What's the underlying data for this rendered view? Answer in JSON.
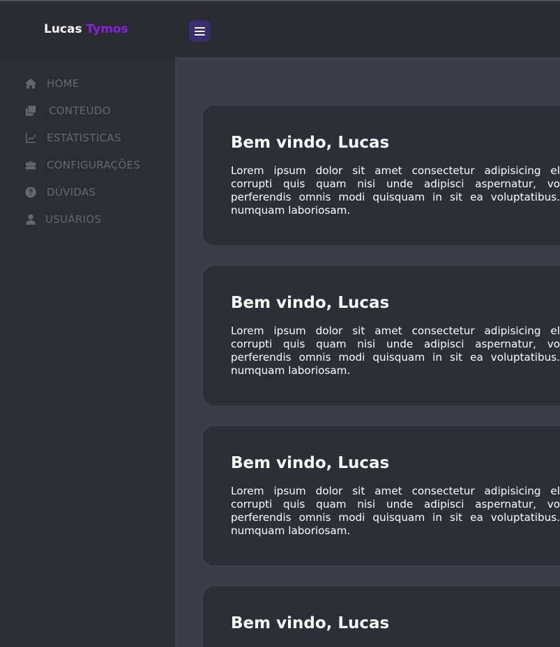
{
  "header": {
    "brand_first": "Lucas",
    "brand_second": "Tymos",
    "brand_accent_color": "#8a1fe0",
    "menu_icon": "hamburger-icon"
  },
  "sidebar": {
    "items": [
      {
        "label": "HOME",
        "icon": "home-icon"
      },
      {
        "label": "CONTEÚDO",
        "icon": "content-icon"
      },
      {
        "label": "ESTÁTISTICAS",
        "icon": "chart-line-icon"
      },
      {
        "label": "CONFIGURAÇÕES",
        "icon": "toolbox-icon"
      },
      {
        "label": "DÚVIDAS",
        "icon": "question-circle-icon"
      },
      {
        "label": "USUÁRIOS",
        "icon": "user-icon"
      }
    ]
  },
  "main": {
    "cards": [
      {
        "title": "Bem vindo, Lucas",
        "text": "Lorem ipsum dolor sit amet consectetur adipisicing el corrupti quis quam nisi unde adipisci aspernatur, vo perferendis omnis modi quisquam in sit ea voluptatibus. numquam laboriosam."
      },
      {
        "title": "Bem vindo, Lucas",
        "text": "Lorem ipsum dolor sit amet consectetur adipisicing el corrupti quis quam nisi unde adipisci aspernatur, vo perferendis omnis modi quisquam in sit ea voluptatibus. numquam laboriosam."
      },
      {
        "title": "Bem vindo, Lucas",
        "text": "Lorem ipsum dolor sit amet consectetur adipisicing el corrupti quis quam nisi unde adipisci aspernatur, vo perferendis omnis modi quisquam in sit ea voluptatibus. numquam laboriosam."
      },
      {
        "title": "Bem vindo, Lucas",
        "text": ""
      }
    ]
  }
}
